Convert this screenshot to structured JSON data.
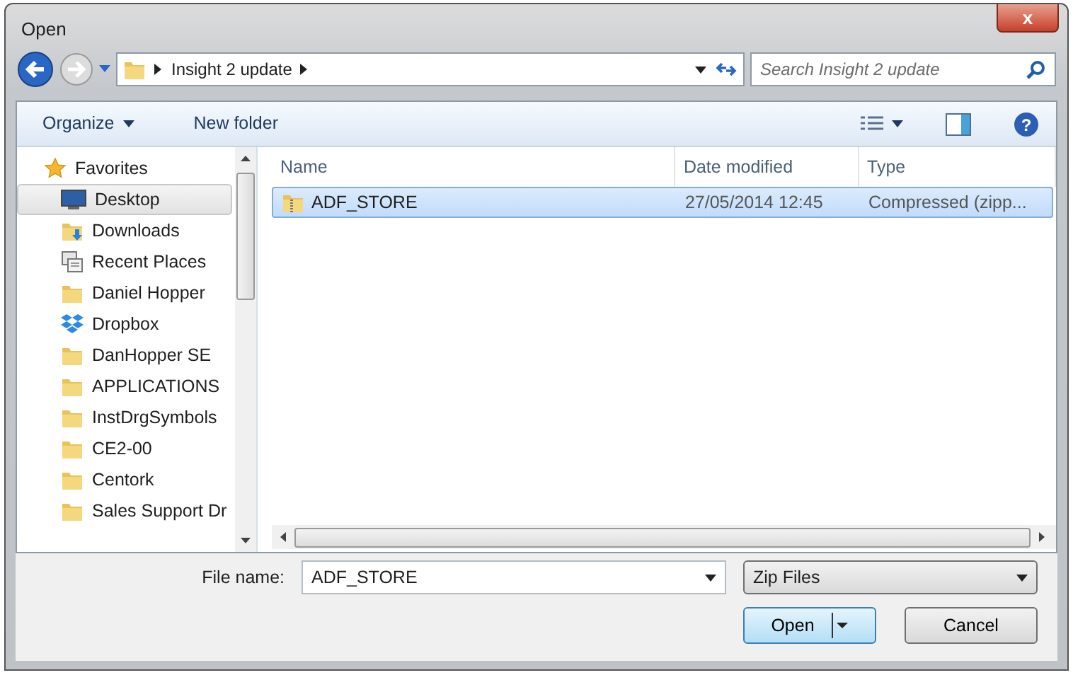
{
  "window": {
    "title": "Open",
    "close_symbol": "x"
  },
  "address": {
    "path": [
      "Insight 2 update"
    ]
  },
  "search": {
    "placeholder": "Search Insight 2 update"
  },
  "toolbar": {
    "organize": "Organize",
    "new_folder": "New folder",
    "help_symbol": "?"
  },
  "sidebar": {
    "items": [
      {
        "label": "Favorites",
        "kind": "header",
        "selected": false
      },
      {
        "label": "Desktop",
        "kind": "desktop",
        "selected": true
      },
      {
        "label": "Downloads",
        "kind": "downloads",
        "selected": false
      },
      {
        "label": "Recent Places",
        "kind": "recent",
        "selected": false
      },
      {
        "label": "Daniel Hopper",
        "kind": "folder",
        "selected": false
      },
      {
        "label": "Dropbox",
        "kind": "dropbox",
        "selected": false
      },
      {
        "label": "DanHopper SE",
        "kind": "folder",
        "selected": false
      },
      {
        "label": "APPLICATIONS",
        "kind": "folder",
        "selected": false
      },
      {
        "label": "InstDrgSymbols",
        "kind": "folder",
        "selected": false
      },
      {
        "label": "CE2-00",
        "kind": "folder",
        "selected": false
      },
      {
        "label": "Centork",
        "kind": "folder",
        "selected": false
      },
      {
        "label": "Sales Support Dr",
        "kind": "folder",
        "selected": false
      }
    ]
  },
  "table": {
    "columns": [
      "Name",
      "Date modified",
      "Type"
    ],
    "rows": [
      {
        "name": "ADF_STORE",
        "date_modified": "27/05/2014 12:45",
        "type": "Compressed (zipp...",
        "selected": true
      }
    ]
  },
  "file_name": {
    "label": "File name:",
    "value": "ADF_STORE"
  },
  "file_type": {
    "value": "Zip Files"
  },
  "buttons": {
    "open": "Open",
    "cancel": "Cancel"
  }
}
